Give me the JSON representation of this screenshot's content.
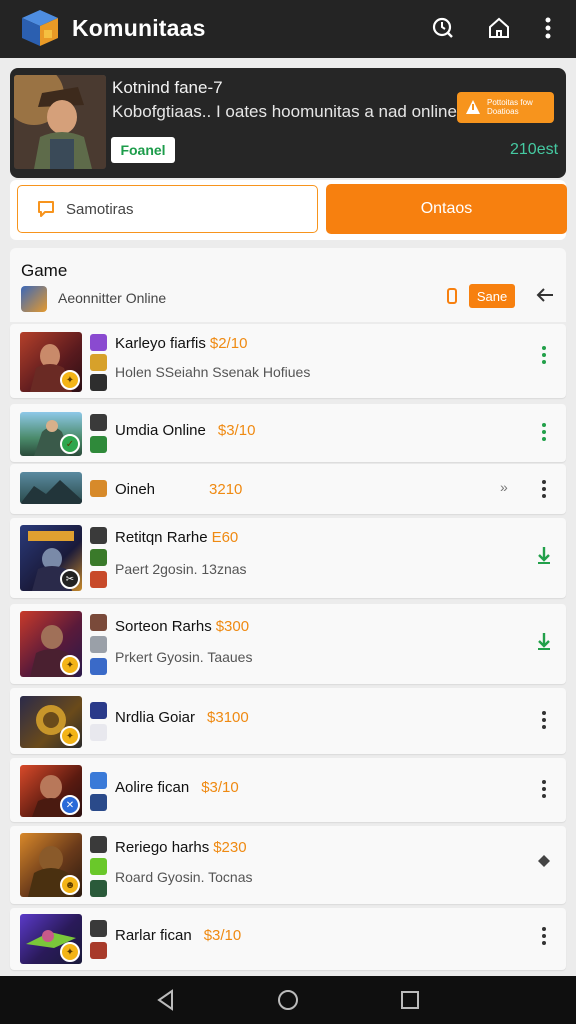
{
  "app": {
    "title": "Komunitaas",
    "colors": {
      "accent": "#f7800f",
      "topbar": "#242424",
      "green": "#1c9c4a"
    }
  },
  "topbar": {
    "icons": [
      "clock-search-icon",
      "home-icon",
      "more-vert-icon"
    ]
  },
  "banner": {
    "title": "Kotnind fane-7",
    "subtitle": "Kobofgtiaas.. I oates hoomunitas a nad online",
    "button_label": "Foanel",
    "promo_line1": "Pottoitas fow",
    "promo_line2": "Doatioas",
    "count": "210est"
  },
  "segment": {
    "search_label": "Samotiras",
    "online_label": "Ontaos"
  },
  "section": {
    "title": "Game",
    "subtitle": "Aeonnitter Online",
    "badge": "Sane"
  },
  "rows": [
    {
      "title": "Karleyo fiarfis",
      "price": "$2/10",
      "subtitle": "Holen SSeiahn Ssenak Hofiues",
      "action": "more-vert-icon"
    },
    {
      "title": "Umdia Online",
      "price": "$3/10",
      "subtitle": "",
      "action": "more-vert-icon"
    },
    {
      "title": "Oineh",
      "price": "3210",
      "subtitle": "",
      "action": "more-vert-icon"
    },
    {
      "title": "Retitqn Rarhe",
      "price": "E60",
      "subtitle": "Paert 2gosin. 13znas",
      "action": "download-icon"
    },
    {
      "title": "Sorteon Rarhs",
      "price": "$300",
      "subtitle": "Prkert Gyosin. Taaues",
      "action": "download-icon"
    },
    {
      "title": "Nrdlia Goiar",
      "price": "$3100",
      "subtitle": "",
      "action": "more-vert-icon"
    },
    {
      "title": "Aolire fican",
      "price": "$3/10",
      "subtitle": "",
      "action": "more-vert-icon"
    },
    {
      "title": "Reriego harhs",
      "price": "$230",
      "subtitle": "Roard Gyosin. Tocnas",
      "action": "diamond-icon"
    },
    {
      "title": "Rarlar fican",
      "price": "$3/10",
      "subtitle": "",
      "action": "more-vert-icon"
    }
  ],
  "navbar": {
    "icons": [
      "back-icon",
      "home-circle-icon",
      "recents-icon"
    ]
  }
}
